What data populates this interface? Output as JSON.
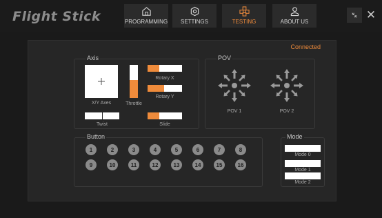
{
  "app": {
    "title": "Flight Stick"
  },
  "nav": [
    {
      "label": "PROGRAMMING",
      "icon": "home-icon"
    },
    {
      "label": "SETTINGS",
      "icon": "gear-icon"
    },
    {
      "label": "TESTING",
      "icon": "joystick-icon",
      "active": true
    },
    {
      "label": "ABOUT US",
      "icon": "user-icon"
    }
  ],
  "window": {
    "minimize_icon": "collapse-icon",
    "close_icon": "close-icon",
    "close_glyph": "✕"
  },
  "status": {
    "text": "Connected"
  },
  "axis": {
    "title": "Axis",
    "xy_label": "X/Y Axes",
    "throttle_label": "Throttle",
    "throttle_value": 0.55,
    "rotary_x_label": "Rotary X",
    "rotary_x_value": 0.33,
    "rotary_y_label": "Rotary Y",
    "rotary_y_value": 0.48,
    "twist_label": "Twist",
    "twist_value": 0.5,
    "slide_label": "Slide",
    "slide_value": 0.33
  },
  "pov": {
    "title": "POV",
    "pov1_label": "POV 1",
    "pov2_label": "POV 2"
  },
  "buttons": {
    "title": "Button",
    "row1": [
      "1",
      "2",
      "3",
      "4",
      "5",
      "6",
      "7",
      "8"
    ],
    "row2": [
      "9",
      "10",
      "11",
      "12",
      "13",
      "14",
      "15",
      "16"
    ]
  },
  "mode": {
    "title": "Mode",
    "items": [
      "Mode 0",
      "Mode 1",
      "Mode 2"
    ]
  },
  "colors": {
    "accent": "#ef8b3b",
    "background": "#1a1a1a",
    "panel": "#262626"
  }
}
